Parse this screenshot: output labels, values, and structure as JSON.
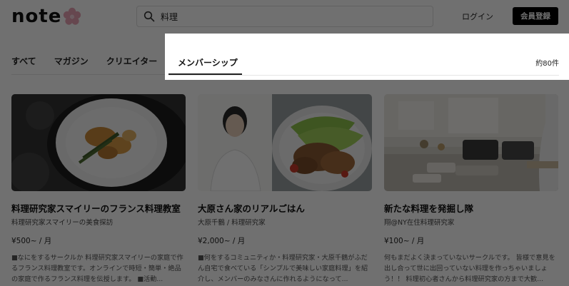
{
  "header": {
    "logo_text": "note",
    "search_value": "料理",
    "login_label": "ログイン",
    "signup_label": "会員登録"
  },
  "tabs": [
    {
      "label": "すべて"
    },
    {
      "label": "マガジン"
    },
    {
      "label": "クリエイター"
    },
    {
      "label": "メンバーシップ",
      "active": true
    }
  ],
  "result_count": "約80件",
  "cards": [
    {
      "title": "料理研究家スマイリーのフランス料理教室",
      "owner": "料理研究家スマイリーの美食探訪",
      "price": "¥500~ / 月",
      "description": "■なにをするサークルか 料理研究家スマイリーの家庭で作るフランス料理教室です。オンラインで時短・簡単・絶品の家庭で作るフランス料理を伝授します。 ■活動..."
    },
    {
      "title": "大原さん家のリアルごはん",
      "owner": "大原千鶴 / 料理研究家",
      "price": "¥2,000~ / 月",
      "description": "■何をするコミュニティか・料理研究家・大原千鶴がふだん自宅で食べている「シンプルで美味しい家庭料理」を紹介し、メンバーのみなさんに作れるようになって..."
    },
    {
      "title": "新たな料理を発掘し隊",
      "owner": "翔@NY在住料理研究家",
      "price": "¥100~ / 月",
      "description": "何もまだよく決まっていないサークルです。 皆様で意見を出し合って世に出回っていない料理を作っちゃいましょう！！ 料理初心者さんから料理研究家の方まで大歓..."
    }
  ],
  "colors": {
    "brand": "#000000",
    "overlay": "rgba(0,0,0,0.56)",
    "logo_flower": "#e8a3b4"
  },
  "icons": {
    "search": "search-icon",
    "logo": "note-flower-icon"
  }
}
